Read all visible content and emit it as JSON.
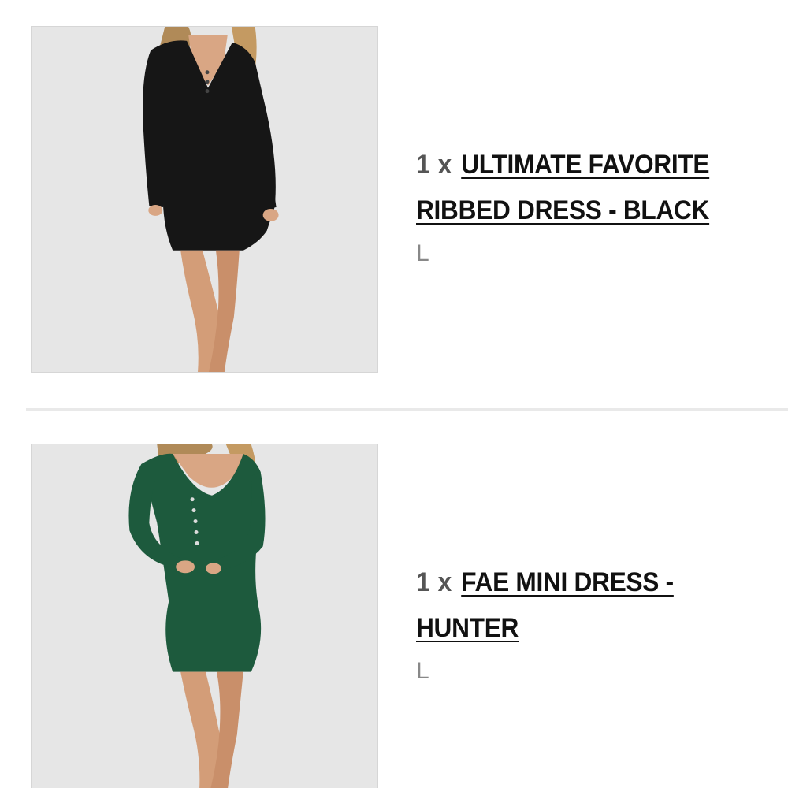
{
  "colors": {
    "dress_black": "#161616",
    "dress_hunter": "#1d5a3d",
    "background_thumb": "#e6e6e6",
    "divider": "#e9e9e9"
  },
  "items": [
    {
      "quantity": "1",
      "times": "x",
      "name_line1": "ULTIMATE FAVORITE",
      "name_line2": "RIBBED DRESS - BLACK",
      "size": "L",
      "image_alt": "black ribbed mini dress"
    },
    {
      "quantity": "1",
      "times": "x",
      "name_line1": "FAE MINI DRESS -",
      "name_line2": "HUNTER",
      "size": "L",
      "image_alt": "hunter green ribbed mini dress"
    }
  ]
}
